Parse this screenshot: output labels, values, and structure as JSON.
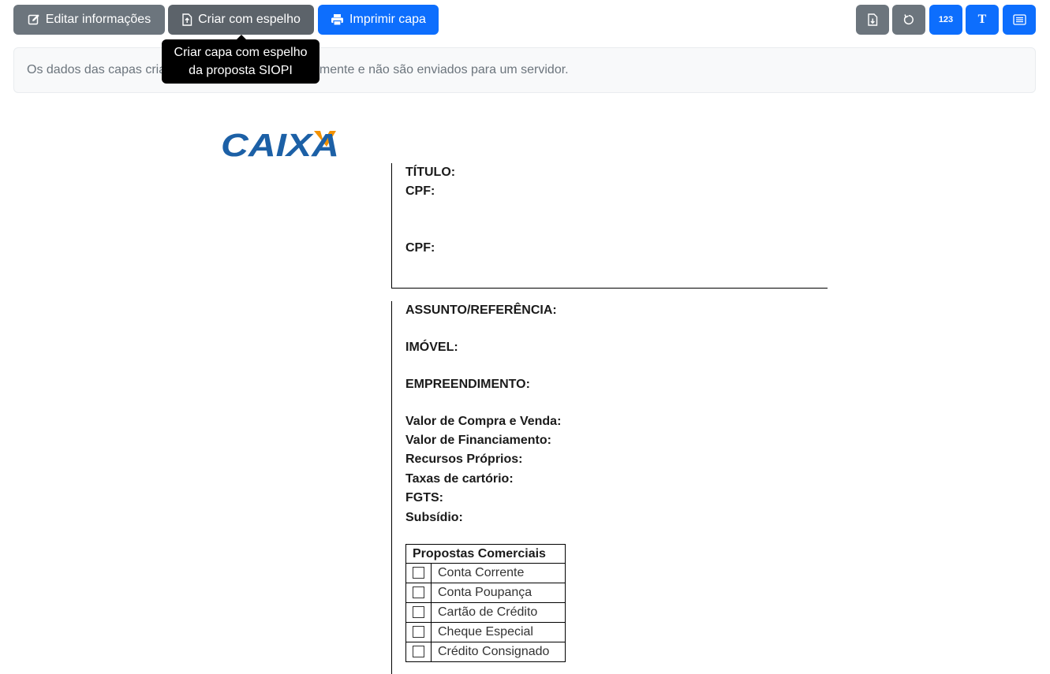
{
  "toolbar": {
    "edit_label": "Editar informações",
    "mirror_label": "Criar com espelho",
    "print_label": "Imprimir capa",
    "number_label": "123",
    "text_label": "T",
    "right_icons": [
      "file-download-icon",
      "reset-icon",
      "numbers-icon",
      "text-icon",
      "list-icon"
    ]
  },
  "tooltip": {
    "line1": "Criar capa com espelho",
    "line2": "da proposta SIOPI"
  },
  "info": {
    "text": "Os dados das capas criadas são armazenados localmente e não são enviados para um servidor."
  },
  "logo": {
    "text": "CAIXA"
  },
  "cover": {
    "titulo": "TÍTULO:",
    "cpf1": "CPF:",
    "cpf2": "CPF:",
    "assunto": "ASSUNTO/REFERÊNCIA:",
    "imovel": "IMÓVEL:",
    "empreendimento": "EMPREENDIMENTO:",
    "valor_compra": "Valor de Compra e Venda:",
    "valor_financiamento": "Valor de Financiamento:",
    "recursos": "Recursos Próprios:",
    "taxas": "Taxas de cartório:",
    "fgts": "FGTS:",
    "subsidio": "Subsídio:"
  },
  "proposals": {
    "header": "Propostas Comerciais",
    "items": [
      "Conta Corrente",
      "Conta Poupança",
      "Cartão de Crédito",
      "Cheque Especial",
      "Crédito Consignado"
    ]
  },
  "colors": {
    "gray": "#6c757d",
    "blue": "#0d6efd",
    "caixa_blue": "#1c60a6",
    "caixa_orange": "#f39200"
  }
}
